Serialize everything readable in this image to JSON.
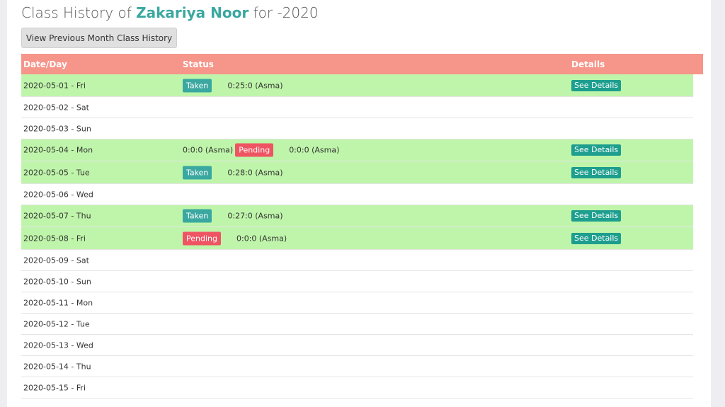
{
  "heading": {
    "prefix": "Class History of",
    "name": "Zakariya Noor",
    "suffix": "for -2020"
  },
  "prev_button": "View Previous Month Class History",
  "table": {
    "headers": {
      "date": "Date/Day",
      "status": "Status",
      "details": "Details"
    },
    "details_label": "See Details",
    "rows": [
      {
        "date": "2020-05-01 - Fri",
        "active": true,
        "badge": "Taken",
        "badge_type": "taken",
        "duration": "0:25:0 (Asma)"
      },
      {
        "date": "2020-05-02 - Sat",
        "active": false
      },
      {
        "date": "2020-05-03 - Sun",
        "active": false
      },
      {
        "date": "2020-05-04 - Mon",
        "active": true,
        "pre": "0:0:0 (Asma)",
        "badge": "Pending",
        "badge_type": "pending",
        "duration": "0:0:0 (Asma)"
      },
      {
        "date": "2020-05-05 - Tue",
        "active": true,
        "badge": "Taken",
        "badge_type": "taken",
        "duration": "0:28:0 (Asma)"
      },
      {
        "date": "2020-05-06 - Wed",
        "active": false
      },
      {
        "date": "2020-05-07 - Thu",
        "active": true,
        "badge": "Taken",
        "badge_type": "taken",
        "duration": "0:27:0 (Asma)"
      },
      {
        "date": "2020-05-08 - Fri",
        "active": true,
        "badge": "Pending",
        "badge_type": "pending",
        "duration": "0:0:0 (Asma)"
      },
      {
        "date": "2020-05-09 - Sat",
        "active": false
      },
      {
        "date": "2020-05-10 - Sun",
        "active": false
      },
      {
        "date": "2020-05-11 - Mon",
        "active": false
      },
      {
        "date": "2020-05-12 - Tue",
        "active": false
      },
      {
        "date": "2020-05-13 - Wed",
        "active": false
      },
      {
        "date": "2020-05-14 - Thu",
        "active": false
      },
      {
        "date": "2020-05-15 - Fri",
        "active": false
      }
    ]
  },
  "colors": {
    "header_bg": "#f6958a",
    "active_row_bg": "#bff5aa",
    "taken_badge": "#3aa8a0",
    "pending_badge": "#ef5462",
    "details_button": "#1d9e8e",
    "name_accent": "#3aa8a0"
  }
}
